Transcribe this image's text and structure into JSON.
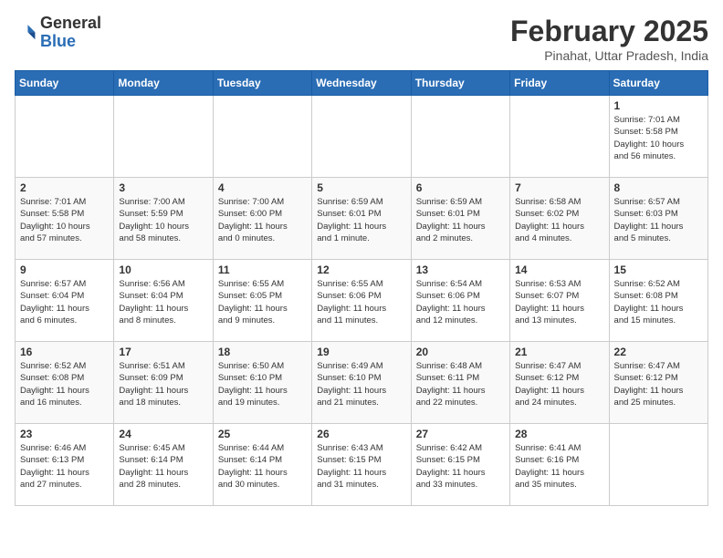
{
  "logo": {
    "general": "General",
    "blue": "Blue"
  },
  "title": "February 2025",
  "subtitle": "Pinahat, Uttar Pradesh, India",
  "days_of_week": [
    "Sunday",
    "Monday",
    "Tuesday",
    "Wednesday",
    "Thursday",
    "Friday",
    "Saturday"
  ],
  "weeks": [
    [
      {
        "day": "",
        "info": ""
      },
      {
        "day": "",
        "info": ""
      },
      {
        "day": "",
        "info": ""
      },
      {
        "day": "",
        "info": ""
      },
      {
        "day": "",
        "info": ""
      },
      {
        "day": "",
        "info": ""
      },
      {
        "day": "1",
        "info": "Sunrise: 7:01 AM\nSunset: 5:58 PM\nDaylight: 10 hours\nand 56 minutes."
      }
    ],
    [
      {
        "day": "2",
        "info": "Sunrise: 7:01 AM\nSunset: 5:58 PM\nDaylight: 10 hours\nand 57 minutes."
      },
      {
        "day": "3",
        "info": "Sunrise: 7:00 AM\nSunset: 5:59 PM\nDaylight: 10 hours\nand 58 minutes."
      },
      {
        "day": "4",
        "info": "Sunrise: 7:00 AM\nSunset: 6:00 PM\nDaylight: 11 hours\nand 0 minutes."
      },
      {
        "day": "5",
        "info": "Sunrise: 6:59 AM\nSunset: 6:01 PM\nDaylight: 11 hours\nand 1 minute."
      },
      {
        "day": "6",
        "info": "Sunrise: 6:59 AM\nSunset: 6:01 PM\nDaylight: 11 hours\nand 2 minutes."
      },
      {
        "day": "7",
        "info": "Sunrise: 6:58 AM\nSunset: 6:02 PM\nDaylight: 11 hours\nand 4 minutes."
      },
      {
        "day": "8",
        "info": "Sunrise: 6:57 AM\nSunset: 6:03 PM\nDaylight: 11 hours\nand 5 minutes."
      }
    ],
    [
      {
        "day": "9",
        "info": "Sunrise: 6:57 AM\nSunset: 6:04 PM\nDaylight: 11 hours\nand 6 minutes."
      },
      {
        "day": "10",
        "info": "Sunrise: 6:56 AM\nSunset: 6:04 PM\nDaylight: 11 hours\nand 8 minutes."
      },
      {
        "day": "11",
        "info": "Sunrise: 6:55 AM\nSunset: 6:05 PM\nDaylight: 11 hours\nand 9 minutes."
      },
      {
        "day": "12",
        "info": "Sunrise: 6:55 AM\nSunset: 6:06 PM\nDaylight: 11 hours\nand 11 minutes."
      },
      {
        "day": "13",
        "info": "Sunrise: 6:54 AM\nSunset: 6:06 PM\nDaylight: 11 hours\nand 12 minutes."
      },
      {
        "day": "14",
        "info": "Sunrise: 6:53 AM\nSunset: 6:07 PM\nDaylight: 11 hours\nand 13 minutes."
      },
      {
        "day": "15",
        "info": "Sunrise: 6:52 AM\nSunset: 6:08 PM\nDaylight: 11 hours\nand 15 minutes."
      }
    ],
    [
      {
        "day": "16",
        "info": "Sunrise: 6:52 AM\nSunset: 6:08 PM\nDaylight: 11 hours\nand 16 minutes."
      },
      {
        "day": "17",
        "info": "Sunrise: 6:51 AM\nSunset: 6:09 PM\nDaylight: 11 hours\nand 18 minutes."
      },
      {
        "day": "18",
        "info": "Sunrise: 6:50 AM\nSunset: 6:10 PM\nDaylight: 11 hours\nand 19 minutes."
      },
      {
        "day": "19",
        "info": "Sunrise: 6:49 AM\nSunset: 6:10 PM\nDaylight: 11 hours\nand 21 minutes."
      },
      {
        "day": "20",
        "info": "Sunrise: 6:48 AM\nSunset: 6:11 PM\nDaylight: 11 hours\nand 22 minutes."
      },
      {
        "day": "21",
        "info": "Sunrise: 6:47 AM\nSunset: 6:12 PM\nDaylight: 11 hours\nand 24 minutes."
      },
      {
        "day": "22",
        "info": "Sunrise: 6:47 AM\nSunset: 6:12 PM\nDaylight: 11 hours\nand 25 minutes."
      }
    ],
    [
      {
        "day": "23",
        "info": "Sunrise: 6:46 AM\nSunset: 6:13 PM\nDaylight: 11 hours\nand 27 minutes."
      },
      {
        "day": "24",
        "info": "Sunrise: 6:45 AM\nSunset: 6:14 PM\nDaylight: 11 hours\nand 28 minutes."
      },
      {
        "day": "25",
        "info": "Sunrise: 6:44 AM\nSunset: 6:14 PM\nDaylight: 11 hours\nand 30 minutes."
      },
      {
        "day": "26",
        "info": "Sunrise: 6:43 AM\nSunset: 6:15 PM\nDaylight: 11 hours\nand 31 minutes."
      },
      {
        "day": "27",
        "info": "Sunrise: 6:42 AM\nSunset: 6:15 PM\nDaylight: 11 hours\nand 33 minutes."
      },
      {
        "day": "28",
        "info": "Sunrise: 6:41 AM\nSunset: 6:16 PM\nDaylight: 11 hours\nand 35 minutes."
      },
      {
        "day": "",
        "info": ""
      }
    ]
  ]
}
